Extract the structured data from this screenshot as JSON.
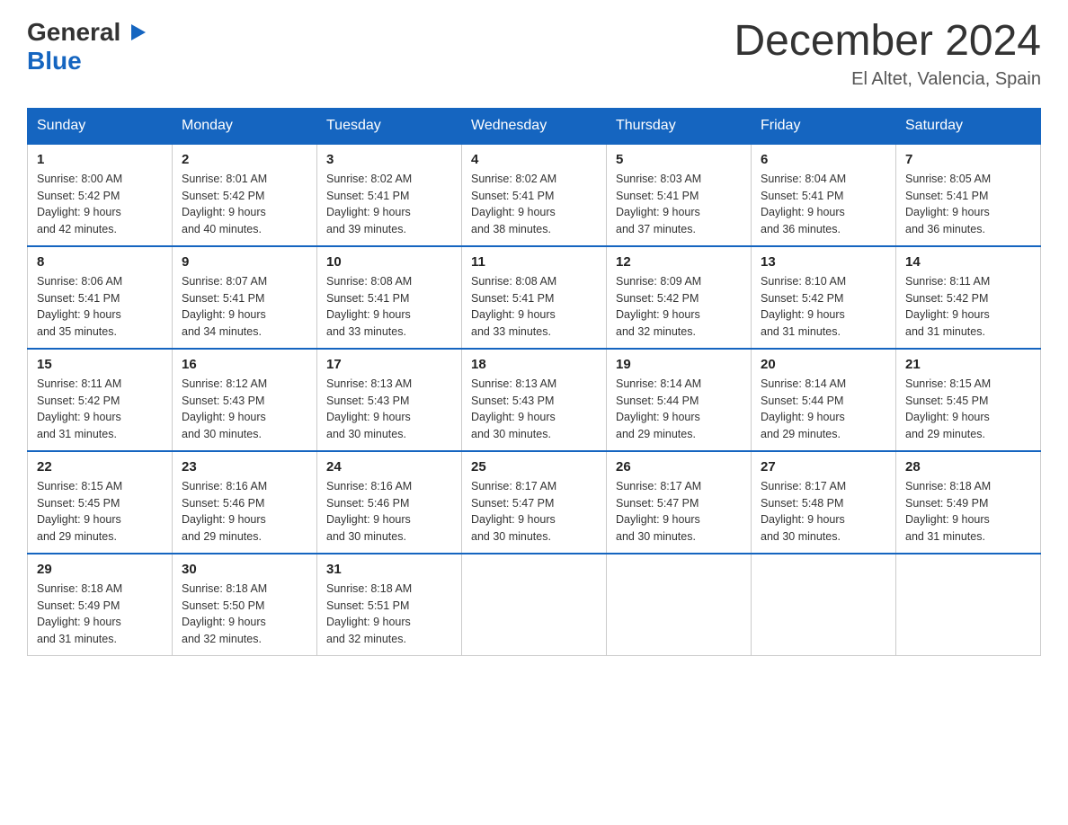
{
  "header": {
    "logo": {
      "general": "General",
      "blue": "Blue",
      "arrow": "▶"
    },
    "title": "December 2024",
    "location": "El Altet, Valencia, Spain"
  },
  "calendar": {
    "days": [
      "Sunday",
      "Monday",
      "Tuesday",
      "Wednesday",
      "Thursday",
      "Friday",
      "Saturday"
    ],
    "weeks": [
      [
        {
          "day": "1",
          "sunrise": "8:00 AM",
          "sunset": "5:42 PM",
          "daylight": "9 hours and 42 minutes."
        },
        {
          "day": "2",
          "sunrise": "8:01 AM",
          "sunset": "5:42 PM",
          "daylight": "9 hours and 40 minutes."
        },
        {
          "day": "3",
          "sunrise": "8:02 AM",
          "sunset": "5:41 PM",
          "daylight": "9 hours and 39 minutes."
        },
        {
          "day": "4",
          "sunrise": "8:02 AM",
          "sunset": "5:41 PM",
          "daylight": "9 hours and 38 minutes."
        },
        {
          "day": "5",
          "sunrise": "8:03 AM",
          "sunset": "5:41 PM",
          "daylight": "9 hours and 37 minutes."
        },
        {
          "day": "6",
          "sunrise": "8:04 AM",
          "sunset": "5:41 PM",
          "daylight": "9 hours and 36 minutes."
        },
        {
          "day": "7",
          "sunrise": "8:05 AM",
          "sunset": "5:41 PM",
          "daylight": "9 hours and 36 minutes."
        }
      ],
      [
        {
          "day": "8",
          "sunrise": "8:06 AM",
          "sunset": "5:41 PM",
          "daylight": "9 hours and 35 minutes."
        },
        {
          "day": "9",
          "sunrise": "8:07 AM",
          "sunset": "5:41 PM",
          "daylight": "9 hours and 34 minutes."
        },
        {
          "day": "10",
          "sunrise": "8:08 AM",
          "sunset": "5:41 PM",
          "daylight": "9 hours and 33 minutes."
        },
        {
          "day": "11",
          "sunrise": "8:08 AM",
          "sunset": "5:41 PM",
          "daylight": "9 hours and 33 minutes."
        },
        {
          "day": "12",
          "sunrise": "8:09 AM",
          "sunset": "5:42 PM",
          "daylight": "9 hours and 32 minutes."
        },
        {
          "day": "13",
          "sunrise": "8:10 AM",
          "sunset": "5:42 PM",
          "daylight": "9 hours and 31 minutes."
        },
        {
          "day": "14",
          "sunrise": "8:11 AM",
          "sunset": "5:42 PM",
          "daylight": "9 hours and 31 minutes."
        }
      ],
      [
        {
          "day": "15",
          "sunrise": "8:11 AM",
          "sunset": "5:42 PM",
          "daylight": "9 hours and 31 minutes."
        },
        {
          "day": "16",
          "sunrise": "8:12 AM",
          "sunset": "5:43 PM",
          "daylight": "9 hours and 30 minutes."
        },
        {
          "day": "17",
          "sunrise": "8:13 AM",
          "sunset": "5:43 PM",
          "daylight": "9 hours and 30 minutes."
        },
        {
          "day": "18",
          "sunrise": "8:13 AM",
          "sunset": "5:43 PM",
          "daylight": "9 hours and 30 minutes."
        },
        {
          "day": "19",
          "sunrise": "8:14 AM",
          "sunset": "5:44 PM",
          "daylight": "9 hours and 29 minutes."
        },
        {
          "day": "20",
          "sunrise": "8:14 AM",
          "sunset": "5:44 PM",
          "daylight": "9 hours and 29 minutes."
        },
        {
          "day": "21",
          "sunrise": "8:15 AM",
          "sunset": "5:45 PM",
          "daylight": "9 hours and 29 minutes."
        }
      ],
      [
        {
          "day": "22",
          "sunrise": "8:15 AM",
          "sunset": "5:45 PM",
          "daylight": "9 hours and 29 minutes."
        },
        {
          "day": "23",
          "sunrise": "8:16 AM",
          "sunset": "5:46 PM",
          "daylight": "9 hours and 29 minutes."
        },
        {
          "day": "24",
          "sunrise": "8:16 AM",
          "sunset": "5:46 PM",
          "daylight": "9 hours and 30 minutes."
        },
        {
          "day": "25",
          "sunrise": "8:17 AM",
          "sunset": "5:47 PM",
          "daylight": "9 hours and 30 minutes."
        },
        {
          "day": "26",
          "sunrise": "8:17 AM",
          "sunset": "5:47 PM",
          "daylight": "9 hours and 30 minutes."
        },
        {
          "day": "27",
          "sunrise": "8:17 AM",
          "sunset": "5:48 PM",
          "daylight": "9 hours and 30 minutes."
        },
        {
          "day": "28",
          "sunrise": "8:18 AM",
          "sunset": "5:49 PM",
          "daylight": "9 hours and 31 minutes."
        }
      ],
      [
        {
          "day": "29",
          "sunrise": "8:18 AM",
          "sunset": "5:49 PM",
          "daylight": "9 hours and 31 minutes."
        },
        {
          "day": "30",
          "sunrise": "8:18 AM",
          "sunset": "5:50 PM",
          "daylight": "9 hours and 32 minutes."
        },
        {
          "day": "31",
          "sunrise": "8:18 AM",
          "sunset": "5:51 PM",
          "daylight": "9 hours and 32 minutes."
        },
        null,
        null,
        null,
        null
      ]
    ]
  }
}
